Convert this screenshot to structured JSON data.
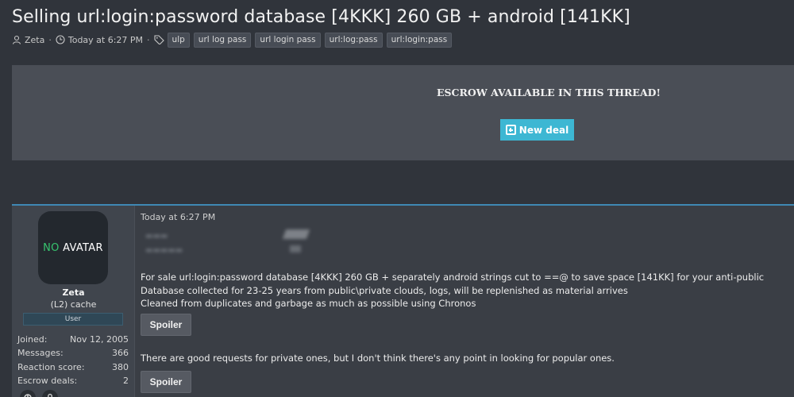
{
  "thread": {
    "title": "Selling url:login:password database [4KKK] 260 GB + android [141KK]",
    "author": "Zeta",
    "date": "Today at 6:27 PM",
    "tags": [
      "ulp",
      "url log pass",
      "url login pass",
      "url:log:pass",
      "url:login:pass"
    ]
  },
  "escrow": {
    "notice": "ESCROW AVAILABLE IN THIS THREAD!",
    "button_label": "New deal",
    "button_color": "#3db7d3"
  },
  "post": {
    "user": {
      "avatar_no": "NO",
      "avatar_text": " AVATAR",
      "name": "Zeta",
      "title": "(L2) cache",
      "banner": "User",
      "stats": [
        {
          "label": "Joined:",
          "value": "Nov 12, 2005"
        },
        {
          "label": "Messages:",
          "value": "366"
        },
        {
          "label": "Reaction score:",
          "value": "380"
        },
        {
          "label": "Escrow deals:",
          "value": "2"
        }
      ]
    },
    "date": "Today at 6:27 PM",
    "lines": [
      "For sale url:login:password database [4KKK] 260 GB + separately android strings cut to ==@ to save space [141KK] for your anti-public",
      "Database collected for 23-25 years from public\\private clouds, logs, will be replenished as material arrives",
      "Cleaned from duplicates and garbage as much as possible using Chronos"
    ],
    "second_text": "There are good requests for private ones, but I don't think there's any point in looking for popular ones.",
    "spoiler_label": "Spoiler"
  }
}
